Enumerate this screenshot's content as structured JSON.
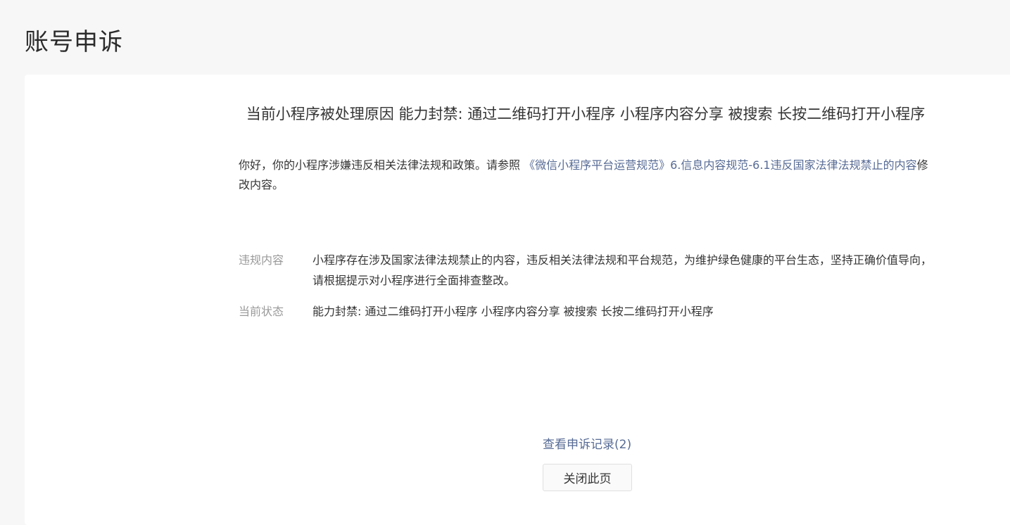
{
  "page": {
    "title": "账号申诉"
  },
  "reason": {
    "title": "当前小程序被处理原因 能力封禁: 通过二维码打开小程序 小程序内容分享 被搜索 长按二维码打开小程序"
  },
  "intro": {
    "prefix": "你好，你的小程序涉嫌违反相关法律法规和政策。请参照 ",
    "link_text": "《微信小程序平台运营规范》6.信息内容规范-6.1违反国家法律法规禁止的内容",
    "suffix": "修改内容。"
  },
  "details": [
    {
      "label": "违规内容",
      "value": "小程序存在涉及国家法律法规禁止的内容，违反相关法律法规和平台规范，为维护绿色健康的平台生态，坚持正确价值导向，请根据提示对小程序进行全面排查整改。"
    },
    {
      "label": "当前状态",
      "value": "能力封禁: 通过二维码打开小程序 小程序内容分享 被搜索 长按二维码打开小程序"
    }
  ],
  "footer": {
    "records_link": "查看申诉记录(2)",
    "close_button": "关闭此页"
  }
}
